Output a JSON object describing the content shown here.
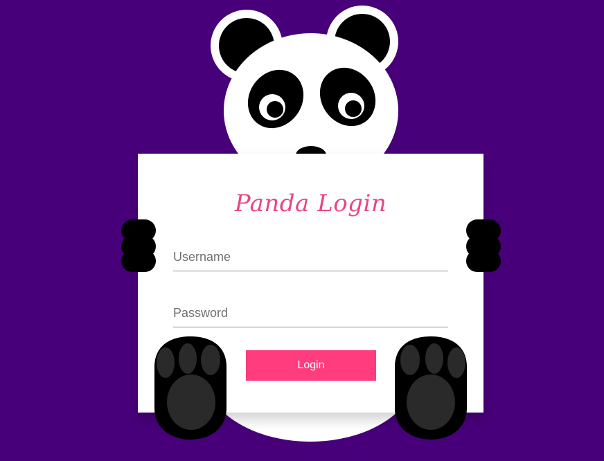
{
  "title": "Panda Login",
  "form": {
    "username_placeholder": "Username",
    "password_placeholder": "Password",
    "login_label": "Login"
  },
  "colors": {
    "background": "#48007a",
    "card": "#ffffff",
    "accent": "#ff3c7d",
    "title": "#e94587"
  }
}
